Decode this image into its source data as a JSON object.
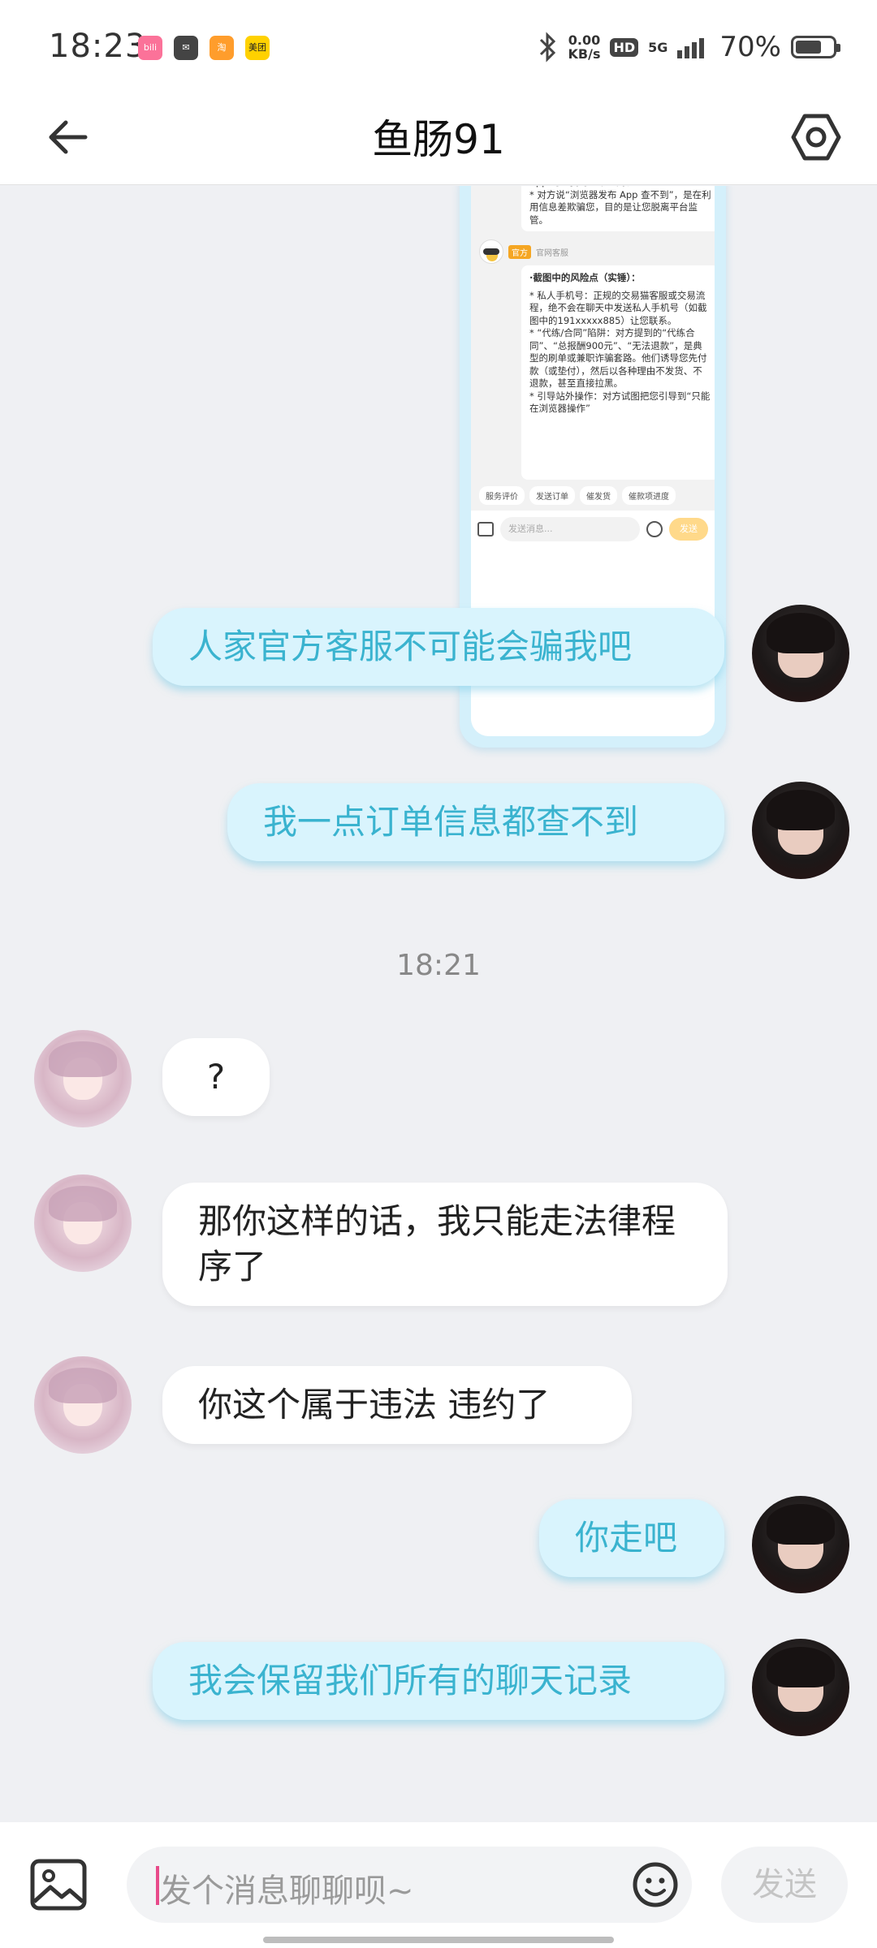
{
  "status_bar": {
    "time": "18:23",
    "net_speed_value": "0.00",
    "net_speed_unit": "KB/s",
    "hd_label": "HD",
    "network_label": "5G",
    "battery_percent": "70%",
    "battery_level": 0.7,
    "app_icons": [
      {
        "name": "bilibili-app-icon",
        "color": "#fb7299"
      },
      {
        "name": "mail-app-icon",
        "color": "#444444"
      },
      {
        "name": "taobao-app-icon",
        "color": "#ff9d2c"
      },
      {
        "name": "meituan-app-icon",
        "color": "#ffd100",
        "label": "美团"
      }
    ]
  },
  "header": {
    "title": "鱼肠91"
  },
  "screenshot_image": {
    "top_card_text": "App 的【我的订单】列表里。\n* 对方说“浏览器发布 App 查不到”，是在利用信息差欺骗您，目的是让您脱离平台监管。",
    "agent_tag": "官方",
    "agent_name": "官网客服",
    "main_card_title": "·截图中的风险点（实锤）：",
    "main_card_text": "* 私人手机号：正规的交易猫客服或交易流程，绝不会在聊天中发送私人手机号（如截图中的191xxxxx885）让您联系。\n* “代练/合同”陷阱：对方提到的“代练合同”、“总报酬900元”、“无法退款”，是典型的刷单或兼职诈骗套路。他们诱导您先付款（或垫付），然后以各种理由不发货、不退款，甚至直接拉黑。\n* 引导站外操作：对方试图把您引导到“只能在浏览器操作”",
    "quick_actions": [
      "服务评价",
      "发送订单",
      "催发货",
      "催款项进度"
    ],
    "input_placeholder": "发送消息...",
    "send_label": "发送"
  },
  "messages": [
    {
      "side": "mine",
      "text": "人家官方客服不可能会骗我吧"
    },
    {
      "side": "mine",
      "text": "我一点订单信息都查不到"
    },
    {
      "side": "theirs",
      "text": "?"
    },
    {
      "side": "theirs",
      "text": "那你这样的话，我只能走法律程序了"
    },
    {
      "side": "theirs",
      "text": "你这个属于违法 违约了"
    },
    {
      "side": "mine",
      "text": "你走吧"
    },
    {
      "side": "mine",
      "text": "我会保留我们所有的聊天记录"
    }
  ],
  "time_separator": "18:21",
  "input_bar": {
    "placeholder": "发个消息聊聊呗~",
    "send_label": "发送"
  },
  "colors": {
    "mine_bubble_bg": "#d9f4fd",
    "mine_bubble_text": "#3ab3cf",
    "theirs_bubble_bg": "#ffffff",
    "chat_bg": "#eff0f3"
  }
}
